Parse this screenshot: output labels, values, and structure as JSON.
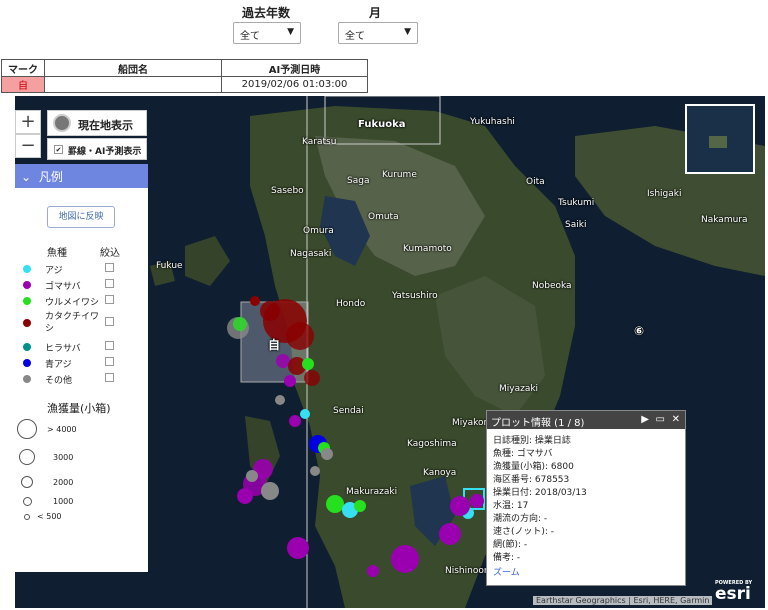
{
  "filters": {
    "year_label": "過去年数",
    "year_value": "全て",
    "month_label": "月",
    "month_value": "全て",
    "arrow": "▼"
  },
  "table": {
    "headers": [
      "マーク",
      "船団名",
      "AI予測日時"
    ],
    "row": {
      "mark": "自",
      "fleet": "",
      "datetime": "2019/02/06 01:03:00"
    }
  },
  "map": {
    "places": [
      {
        "name": "Fukuoka",
        "big": true
      },
      {
        "name": "Karatsu"
      },
      {
        "name": "Yukuhashi"
      },
      {
        "name": "Sasebo"
      },
      {
        "name": "Saga"
      },
      {
        "name": "Kurume"
      },
      {
        "name": "Oita"
      },
      {
        "name": "Tsukumi"
      },
      {
        "name": "Omura"
      },
      {
        "name": "Omuta"
      },
      {
        "name": "Saiki"
      },
      {
        "name": "Nakamura"
      },
      {
        "name": "Ishigaki"
      },
      {
        "name": "Nagasaki"
      },
      {
        "name": "Kumamoto"
      },
      {
        "name": "Fukue"
      },
      {
        "name": "Yatsushiro"
      },
      {
        "name": "Nobeoka"
      },
      {
        "name": "Hondo"
      },
      {
        "name": "Miyazaki"
      },
      {
        "name": "Sendai"
      },
      {
        "name": "Miyakonojo"
      },
      {
        "name": "Kagoshima"
      },
      {
        "name": "Kanoya"
      },
      {
        "name": "Makurazaki"
      },
      {
        "name": "Nishinoomote"
      }
    ],
    "marker_label": "自",
    "cluster_label": "⑥",
    "attribution": "Earthstar Geographics | Esri, HERE, Garmin",
    "powered_by": "POWERED BY",
    "esri": "esri"
  },
  "controls": {
    "zoom_in": "+",
    "zoom_out": "−",
    "locate_label": "現在地表示",
    "grid_label": "罫線・AI予測表示",
    "grid_checked": "✔"
  },
  "legend": {
    "title": "凡例",
    "collapse_icon": "⌄",
    "apply_button": "地図に反映",
    "species_header": "魚種",
    "filter_header": "絞込",
    "species": [
      {
        "name": "アジ",
        "color": "#36e0f0"
      },
      {
        "name": "ゴマサバ",
        "color": "#9b00b0"
      },
      {
        "name": "ウルメイワシ",
        "color": "#26e020"
      },
      {
        "name": "カタクチイワシ",
        "color": "#8a0000"
      },
      {
        "name": "ヒラサバ",
        "color": "#009090"
      },
      {
        "name": "青アジ",
        "color": "#0000e0"
      },
      {
        "name": "その他",
        "color": "#888888"
      }
    ],
    "catch_header": "漁獲量(小箱)",
    "sizes": [
      "> 4000",
      "3000",
      "2000",
      "1000",
      "< 500"
    ]
  },
  "popup": {
    "title": "プロット情報 (1 / 8)",
    "next": "▶",
    "maximize": "▭",
    "close": "✕",
    "lines": [
      "日誌種別: 操業日誌",
      "魚種: ゴマサバ",
      "漁獲量(小箱): 6800",
      "海区番号: 678553",
      "操業日付: 2018/03/13",
      "水温: 17",
      "潮流の方向: -",
      "速さ(ノット): -",
      "網(節): -",
      "備考: -"
    ],
    "zoom_link": "ズーム"
  }
}
